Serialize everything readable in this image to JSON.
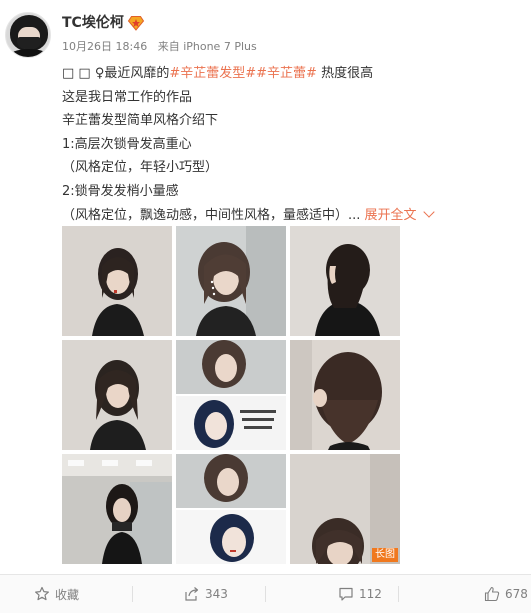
{
  "post": {
    "username": "TC埃伦柯",
    "timestamp": "10月26日 18:46",
    "source": "来自 iPhone 7 Plus",
    "lines": {
      "l1_pre": "□ □ ♀最近风靡的",
      "l1_tag1": "#辛芷蕾发型#",
      "l1_tag2": "#辛芷蕾#",
      "l1_post": " 热度很高",
      "l2": "这是我日常工作的作品",
      "l3": "辛芷蕾发型简单风格介绍下",
      "l4": "1:高层次锁骨发高重心",
      "l5": "（风格定位，年轻小巧型）",
      "l6": "2:锁骨发发梢小量感",
      "l7": "（风格定位，飘逸动感，中间性风格，量感适中）...",
      "expand": "展开全文"
    },
    "images": [
      {
        "icon": "portrait-photo"
      },
      {
        "icon": "haircut-photo"
      },
      {
        "icon": "side-profile-photo"
      },
      {
        "icon": "portrait-photo"
      },
      {
        "icon": "collage-photo"
      },
      {
        "icon": "back-hair-photo"
      },
      {
        "icon": "salon-mirror-photo"
      },
      {
        "icon": "collage-photo"
      },
      {
        "icon": "portrait-photo"
      }
    ],
    "long_image_badge": "长图"
  },
  "actions": {
    "favorite_label": "收藏",
    "repost_count": "343",
    "comment_count": "112",
    "like_count": "678"
  },
  "colors": {
    "accent": "#eb7350",
    "text": "#333333",
    "muted": "#808080",
    "badge": "#f0781e"
  }
}
